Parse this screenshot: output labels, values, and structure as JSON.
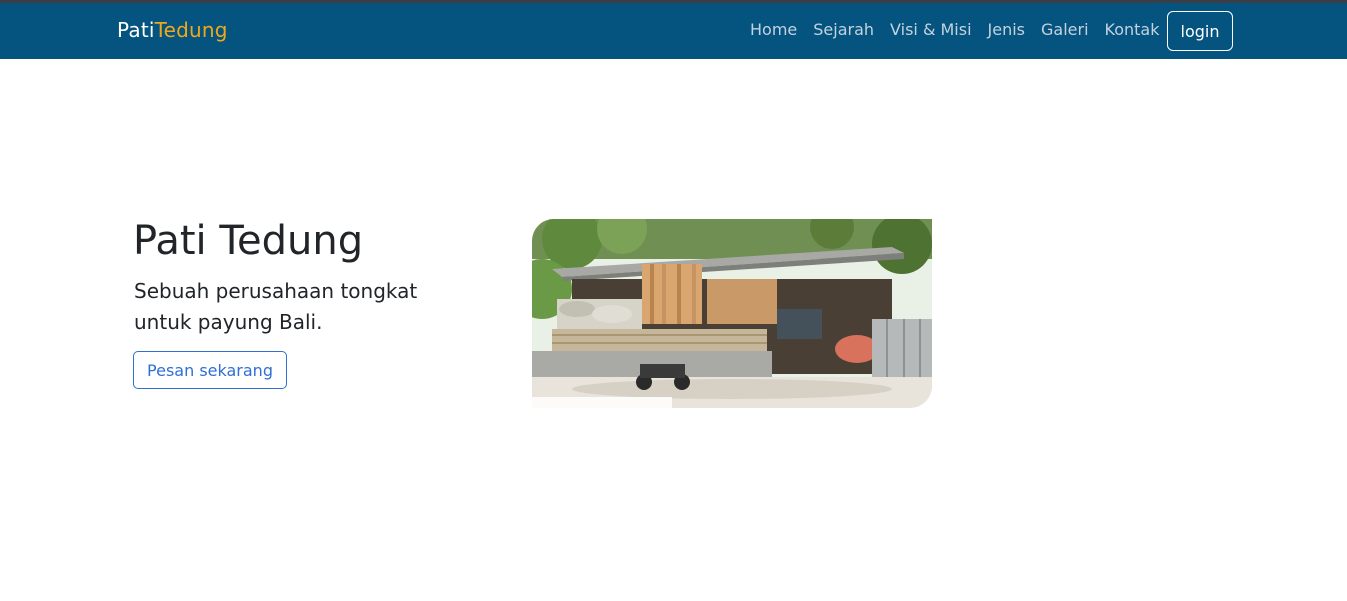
{
  "navbar": {
    "brand_part1": "Pati",
    "brand_part2": "Tedung",
    "links": [
      "Home",
      "Sejarah",
      "Visi & Misi",
      "Jenis",
      "Galeri",
      "Kontak"
    ],
    "login_label": "login"
  },
  "hero": {
    "title": "Pati Tedung",
    "subtitle": "Sebuah perusahaan tongkat untuk payung Bali.",
    "button_label": "Pesan sekarang"
  },
  "colors": {
    "navbar_bg": "#05547f",
    "brand_accent": "#f0a81a",
    "button_outline": "#2f6fd6"
  },
  "icons": {
    "hero_image": "workshop-photo"
  }
}
